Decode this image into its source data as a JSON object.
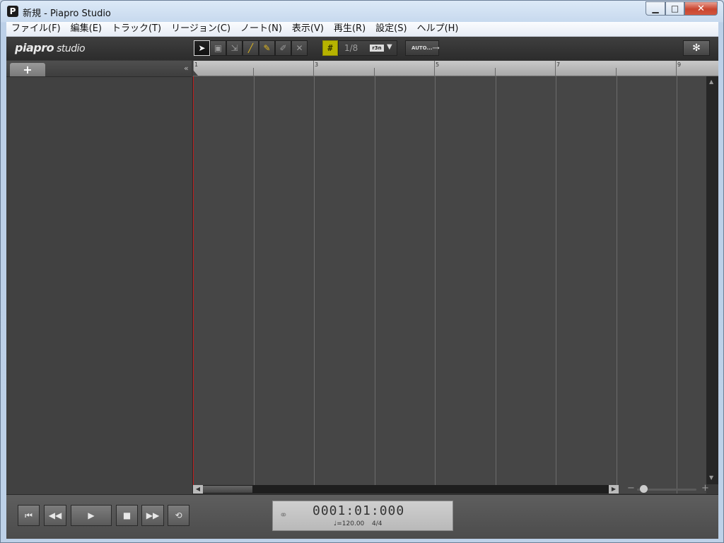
{
  "window": {
    "app_icon": "P",
    "title": "新規 - Piapro Studio",
    "min_glyph": "▁",
    "max_glyph": "□",
    "close_glyph": "✕"
  },
  "menu": [
    "ファイル(F)",
    "編集(E)",
    "トラック(T)",
    "リージョン(C)",
    "ノート(N)",
    "表示(V)",
    "再生(R)",
    "設定(S)",
    "ヘルプ(H)"
  ],
  "logo": {
    "main": "piapro",
    "sub": "studio"
  },
  "tools": [
    {
      "name": "select-tool",
      "icon": "arrow-pointer-icon",
      "glyph": "➤",
      "active": true
    },
    {
      "name": "region-tool",
      "icon": "region-select-icon",
      "glyph": "▣",
      "active": false
    },
    {
      "name": "range-tool",
      "icon": "range-select-icon",
      "glyph": "⇲",
      "active": false
    },
    {
      "name": "line-tool",
      "icon": "line-icon",
      "glyph": "╱",
      "active": false
    },
    {
      "name": "pencil-tool",
      "icon": "pencil-icon",
      "glyph": "✎",
      "active": false
    },
    {
      "name": "edit-tool",
      "icon": "brush-icon",
      "glyph": "✐",
      "active": false
    },
    {
      "name": "erase-tool",
      "icon": "eraser-x-icon",
      "glyph": "✕",
      "active": false
    }
  ],
  "quantize": {
    "grid_icon": "#",
    "value": "1/8",
    "triplet": "r3n",
    "arrow": "▼"
  },
  "auto_label": "AUTO...⟶",
  "settings_glyph": "✻",
  "tracks": {
    "add_glyph": "+",
    "collapse_glyph": "«"
  },
  "ruler": {
    "labels": [
      "1",
      "3",
      "5",
      "7",
      "9"
    ]
  },
  "scroll": {
    "up": "▲",
    "down": "▼",
    "left": "◀",
    "right": "▶"
  },
  "zoom": {
    "minus": "−",
    "plus": "+",
    "level": 0.05
  },
  "transport": {
    "rewind_start": "⏮",
    "rewind": "◀◀",
    "play": "▶",
    "stop": "■",
    "fast_forward": "▶▶",
    "loop": "⟲"
  },
  "clock": {
    "link_glyph": "⚭",
    "time": "0001:01:000",
    "tempo": "♩=120.00",
    "signature": "4/4"
  },
  "colors": {
    "playhead": "#c22020",
    "grid_button": "#b7b300"
  }
}
